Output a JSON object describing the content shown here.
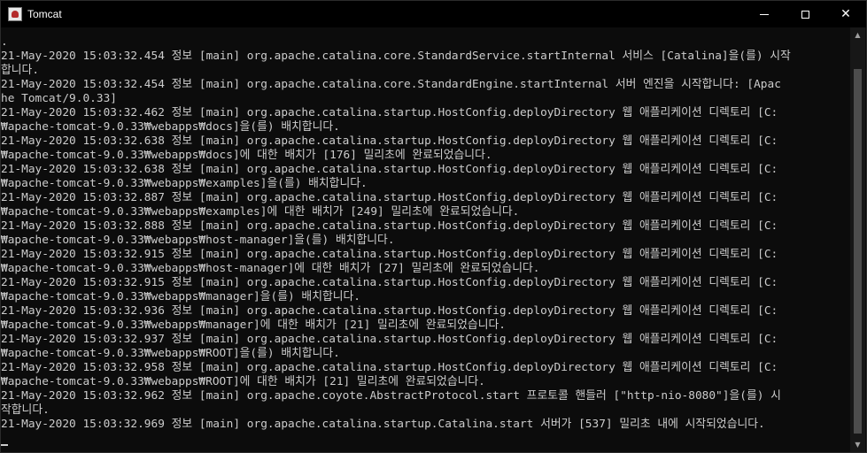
{
  "window": {
    "title": "Tomcat",
    "controls": {
      "minimize": "minimize",
      "maximize": "maximize",
      "close": "✕"
    }
  },
  "console": {
    "lines": [
      ".",
      "21-May-2020 15:03:32.454 정보 [main] org.apache.catalina.core.StandardService.startInternal 서비스 [Catalina]을(를) 시작",
      "합니다.",
      "21-May-2020 15:03:32.454 정보 [main] org.apache.catalina.core.StandardEngine.startInternal 서버 엔진을 시작합니다: [Apac",
      "he Tomcat/9.0.33]",
      "21-May-2020 15:03:32.462 정보 [main] org.apache.catalina.startup.HostConfig.deployDirectory 웹 애플리케이션 디렉토리 [C:",
      "₩apache-tomcat-9.0.33₩webapps₩docs]을(를) 배치합니다.",
      "21-May-2020 15:03:32.638 정보 [main] org.apache.catalina.startup.HostConfig.deployDirectory 웹 애플리케이션 디렉토리 [C:",
      "₩apache-tomcat-9.0.33₩webapps₩docs]에 대한 배치가 [176] 밀리초에 완료되었습니다.",
      "21-May-2020 15:03:32.638 정보 [main] org.apache.catalina.startup.HostConfig.deployDirectory 웹 애플리케이션 디렉토리 [C:",
      "₩apache-tomcat-9.0.33₩webapps₩examples]을(를) 배치합니다.",
      "21-May-2020 15:03:32.887 정보 [main] org.apache.catalina.startup.HostConfig.deployDirectory 웹 애플리케이션 디렉토리 [C:",
      "₩apache-tomcat-9.0.33₩webapps₩examples]에 대한 배치가 [249] 밀리초에 완료되었습니다.",
      "21-May-2020 15:03:32.888 정보 [main] org.apache.catalina.startup.HostConfig.deployDirectory 웹 애플리케이션 디렉토리 [C:",
      "₩apache-tomcat-9.0.33₩webapps₩host-manager]을(를) 배치합니다.",
      "21-May-2020 15:03:32.915 정보 [main] org.apache.catalina.startup.HostConfig.deployDirectory 웹 애플리케이션 디렉토리 [C:",
      "₩apache-tomcat-9.0.33₩webapps₩host-manager]에 대한 배치가 [27] 밀리초에 완료되었습니다.",
      "21-May-2020 15:03:32.915 정보 [main] org.apache.catalina.startup.HostConfig.deployDirectory 웹 애플리케이션 디렉토리 [C:",
      "₩apache-tomcat-9.0.33₩webapps₩manager]을(를) 배치합니다.",
      "21-May-2020 15:03:32.936 정보 [main] org.apache.catalina.startup.HostConfig.deployDirectory 웹 애플리케이션 디렉토리 [C:",
      "₩apache-tomcat-9.0.33₩webapps₩manager]에 대한 배치가 [21] 밀리초에 완료되었습니다.",
      "21-May-2020 15:03:32.937 정보 [main] org.apache.catalina.startup.HostConfig.deployDirectory 웹 애플리케이션 디렉토리 [C:",
      "₩apache-tomcat-9.0.33₩webapps₩ROOT]을(를) 배치합니다.",
      "21-May-2020 15:03:32.958 정보 [main] org.apache.catalina.startup.HostConfig.deployDirectory 웹 애플리케이션 디렉토리 [C:",
      "₩apache-tomcat-9.0.33₩webapps₩ROOT]에 대한 배치가 [21] 밀리초에 완료되었습니다.",
      "21-May-2020 15:03:32.962 정보 [main] org.apache.coyote.AbstractProtocol.start 프로토콜 핸들러 [\"http-nio-8080\"]을(를) 시",
      "작합니다.",
      "21-May-2020 15:03:32.969 정보 [main] org.apache.catalina.startup.Catalina.start 서버가 [537] 밀리초 내에 시작되었습니다."
    ]
  },
  "scrollbar": {
    "up_arrow": "▲",
    "down_arrow": "▼"
  },
  "colors": {
    "background": "#0c0c0c",
    "text": "#cccccc",
    "titlebar": "#000000"
  }
}
